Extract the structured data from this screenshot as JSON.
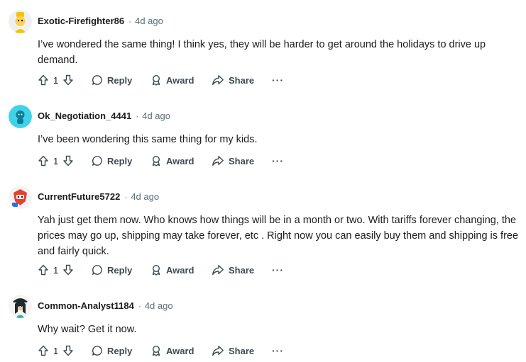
{
  "comments": [
    {
      "author": "Exotic-Firefighter86",
      "separator": "·",
      "time": "4d ago",
      "text": "I’ve wondered the same thing! I think yes, they will be harder to get around the holidays to drive up demand.",
      "votes": "1",
      "avatar_color": "#f5c400"
    },
    {
      "author": "Ok_Negotiation_4441",
      "separator": "·",
      "time": "4d ago",
      "text": "I’ve been wondering this same thing for my kids.",
      "votes": "1",
      "avatar_color": "#3fd2e8"
    },
    {
      "author": "CurrentFuture5722",
      "separator": "·",
      "time": "4d ago",
      "text": "Yah just get them now. Who knows how things will be in a month or two. With tariffs forever changing, the prices may go up, shipping may take forever, etc . Right now you can easily buy them and shipping is free and fairly quick.",
      "votes": "1",
      "avatar_color": "#e5412e"
    },
    {
      "author": "Common-Analyst1184",
      "separator": "·",
      "time": "4d ago",
      "text": "Why wait? Get it now.",
      "votes": "1",
      "avatar_color": "#1b2a2c"
    }
  ],
  "actions": {
    "reply": "Reply",
    "award": "Award",
    "share": "Share",
    "more": "···"
  },
  "icons": {
    "upvote": "upvote-arrow-icon",
    "downvote": "downvote-arrow-icon",
    "reply": "speech-bubble-icon",
    "award": "award-ribbon-icon",
    "share": "share-arrow-icon",
    "more": "overflow-dots-icon"
  }
}
